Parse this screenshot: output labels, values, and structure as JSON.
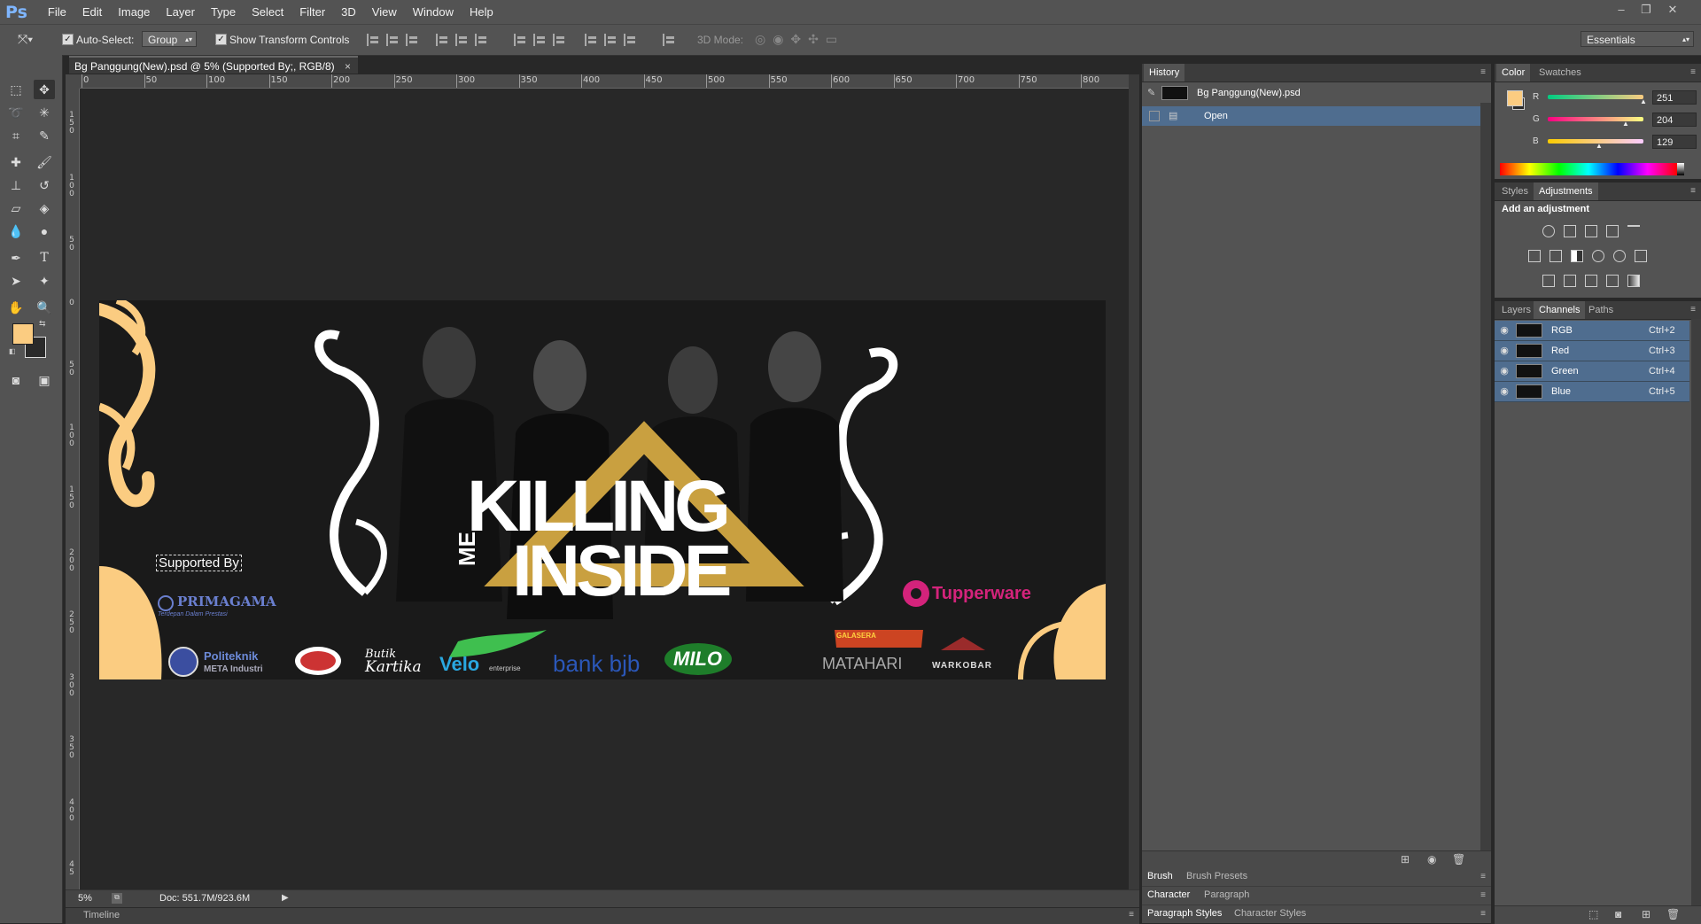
{
  "app": {
    "logo": "Ps"
  },
  "menu": [
    "File",
    "Edit",
    "Image",
    "Layer",
    "Type",
    "Select",
    "Filter",
    "3D",
    "View",
    "Window",
    "Help"
  ],
  "window_controls": [
    "minimize-icon",
    "restore-icon",
    "close-icon"
  ],
  "options_bar": {
    "auto_select_label": "Auto-Select:",
    "auto_select_checked": true,
    "auto_select_value": "Group",
    "show_transform_label": "Show Transform Controls",
    "show_transform_checked": true,
    "mode_3d_label": "3D Mode:",
    "workspace": "Essentials"
  },
  "document": {
    "tab_title": "Bg Panggung(New).psd @ 5% (Supported By;, RGB/8)",
    "close_glyph": "×",
    "ruler_top": [
      "0",
      "50",
      "100",
      "150",
      "200",
      "250",
      "300",
      "350",
      "400",
      "450",
      "500",
      "550",
      "600",
      "650",
      "700",
      "750",
      "800"
    ],
    "ruler_left": [
      "1 5 0",
      "1 0 0",
      "5 0",
      "0",
      "5 0",
      "1 0 0",
      "1 5 0",
      "2 0 0",
      "2 5 0",
      "3 0 0",
      "3 5 0",
      "4 0 0",
      "4 5"
    ],
    "zoom": "5%",
    "doc_size": "Doc: 551.7M/923.6M"
  },
  "banner": {
    "title_line1": "KILLING",
    "title_me": "ME",
    "title_line2": "INSIDE",
    "supported_by": "Supported By",
    "sponsor_primagama": "PRIMAGAMA",
    "sponsor_primagama_tagline": "Terdepan Dalam Prestasi",
    "sponsor_tupperware": "Tupperware",
    "sponsor_politeknik": "Politeknik",
    "sponsor_politeknik_sub": "META Industri",
    "sponsor_butik": "Butik",
    "sponsor_kartika": "Kartika",
    "sponsor_velo": "Velo",
    "sponsor_velo_sub": "enterprise",
    "sponsor_bank": "bank bjb",
    "sponsor_milo": "MILO",
    "sponsor_galasera": "GALASERA",
    "sponsor_matahari": "MATAHARI",
    "sponsor_warkobar": "WARKOBAR"
  },
  "timeline_label": "Timeline",
  "history": {
    "tab": "History",
    "snapshot": "Bg Panggung(New).psd",
    "states": [
      "Open"
    ]
  },
  "color_panel": {
    "tabs": [
      "Color",
      "Swatches"
    ],
    "fg_color": "#fbcc81",
    "r_label": "R",
    "g_label": "G",
    "b_label": "B",
    "r": "251",
    "g": "204",
    "b": "129"
  },
  "adjustments": {
    "tabs": [
      "Styles",
      "Adjustments"
    ],
    "heading": "Add an adjustment"
  },
  "channels": {
    "tabs": [
      "Layers",
      "Channels",
      "Paths"
    ],
    "rows": [
      {
        "name": "RGB",
        "shortcut": "Ctrl+2"
      },
      {
        "name": "Red",
        "shortcut": "Ctrl+3"
      },
      {
        "name": "Green",
        "shortcut": "Ctrl+4"
      },
      {
        "name": "Blue",
        "shortcut": "Ctrl+5"
      }
    ]
  },
  "collapsed_panels": {
    "brush": [
      "Brush",
      "Brush Presets"
    ],
    "character": [
      "Character",
      "Paragraph"
    ],
    "styles": [
      "Paragraph Styles",
      "Character Styles"
    ]
  },
  "colors": {
    "ui_bg": "#535353",
    "canvas_bg": "#282828",
    "accent_gold": "#fbcc81",
    "history_selected": "#4f6d8f"
  }
}
